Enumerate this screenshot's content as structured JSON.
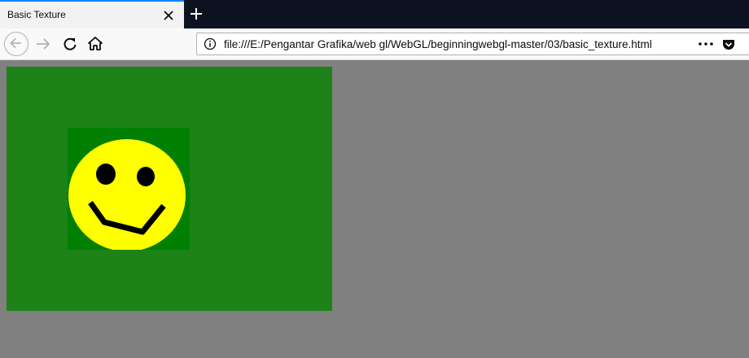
{
  "tab": {
    "title": "Basic Texture"
  },
  "navigation": {
    "url": "file:///E:/Pengantar Grafika/web gl/WebGL/beginningwebgl-master/03/basic_texture.html"
  },
  "colors": {
    "tabbar_bg": "#0c1220",
    "accent": "#0a84ff",
    "page_bg": "#808080",
    "canvas_clear": "#1d8218",
    "texture_bg": "#008000",
    "smiley_face": "#ffff00",
    "smiley_features": "#000000"
  },
  "icons": {
    "tab_close": "close-icon",
    "new_tab": "plus-icon",
    "back": "back-arrow-icon",
    "forward": "forward-arrow-icon",
    "reload": "reload-icon",
    "home": "home-icon",
    "site_info": "info-icon",
    "page_actions": "more-dots-icon",
    "pocket": "pocket-icon"
  }
}
